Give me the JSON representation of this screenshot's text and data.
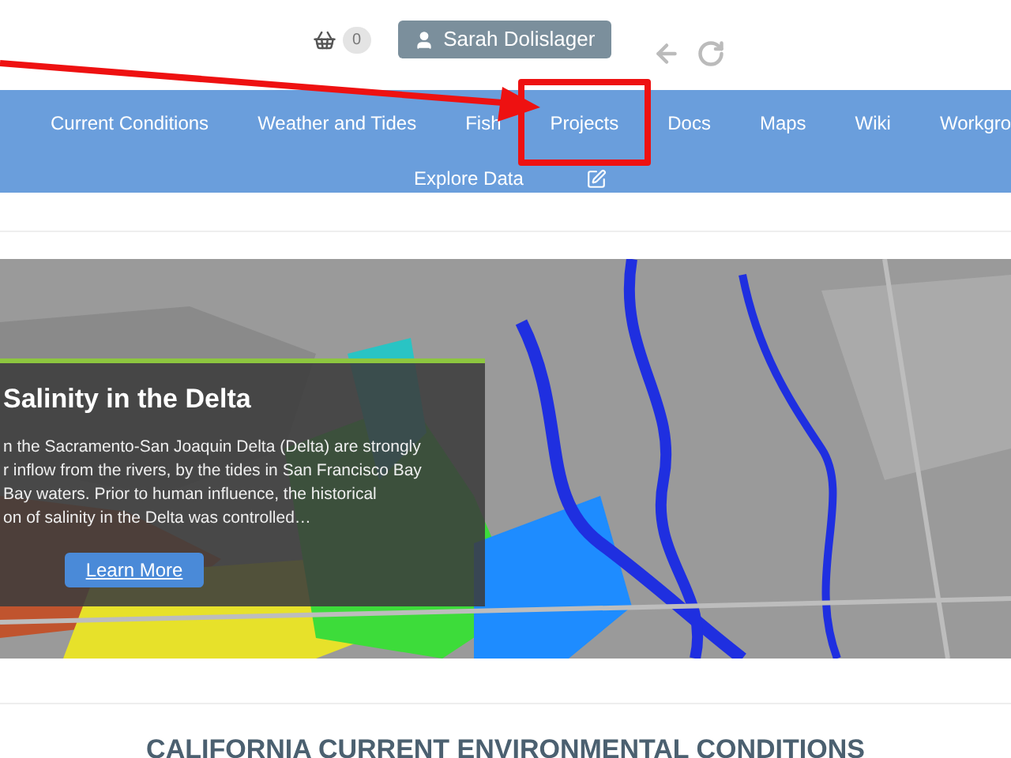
{
  "header": {
    "cart_count": "0",
    "user": "Sarah Dolislager"
  },
  "nav_main": [
    {
      "label": "Current Conditions",
      "highlighted": false
    },
    {
      "label": "Weather and Tides",
      "highlighted": false
    },
    {
      "label": "Fish",
      "highlighted": false
    },
    {
      "label": "Projects",
      "highlighted": true
    },
    {
      "label": "Docs",
      "highlighted": false
    },
    {
      "label": "Maps",
      "highlighted": false
    },
    {
      "label": "Wiki",
      "highlighted": false
    },
    {
      "label": "Workgro",
      "highlighted": false
    }
  ],
  "nav_extra": [
    {
      "label": "Explore Data",
      "highlighted": false
    }
  ],
  "feature": {
    "title": "Salinity in the Delta",
    "lines": [
      "n the Sacramento-San Joaquin Delta (Delta) are strongly",
      "r inflow from the rivers, by the tides in San Francisco Bay",
      "Bay waters. Prior to human influence, the historical",
      "on of salinity in the Delta was controlled…"
    ],
    "button": "Learn More"
  },
  "section_title": "CALIFORNIA CURRENT ENVIRONMENTAL CONDITIONS"
}
